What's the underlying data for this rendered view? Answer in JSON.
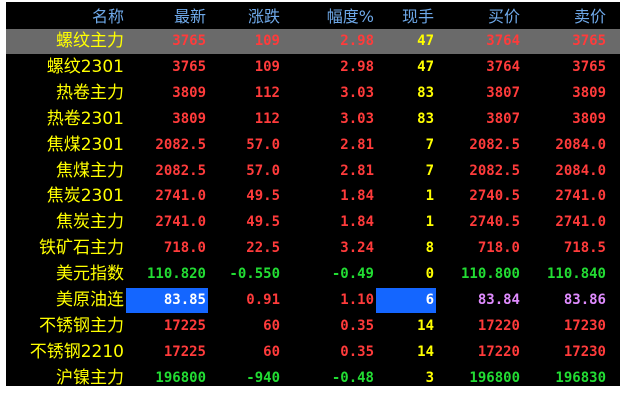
{
  "colors": {
    "up": "#ff3b3b",
    "down": "#22dd33",
    "flat": "#ffff00",
    "volume": "#ffff00",
    "highlight_bg": "#1466ff",
    "selected_bg": "#6a6a6a",
    "header": "#6ea8e8",
    "violet": "#e08cff",
    "white": "#ffffff"
  },
  "columns": {
    "name": "名称",
    "last": "最新",
    "change": "涨跌",
    "pct": "幅度%",
    "volume": "现手",
    "bid": "买价",
    "ask": "卖价"
  },
  "rows": [
    {
      "name": "螺纹主力",
      "last": "3765",
      "change": "109",
      "pct": "2.98",
      "volume": "47",
      "bid": "3764",
      "ask": "3765",
      "selected": true,
      "c_last": "up",
      "c_change": "up",
      "c_pct": "up",
      "c_bid": "up",
      "c_ask": "up"
    },
    {
      "name": "螺纹2301",
      "last": "3765",
      "change": "109",
      "pct": "2.98",
      "volume": "47",
      "bid": "3764",
      "ask": "3765",
      "c_last": "up",
      "c_change": "up",
      "c_pct": "up",
      "c_bid": "up",
      "c_ask": "up"
    },
    {
      "name": "热卷主力",
      "last": "3809",
      "change": "112",
      "pct": "3.03",
      "volume": "83",
      "bid": "3807",
      "ask": "3809",
      "c_last": "up",
      "c_change": "up",
      "c_pct": "up",
      "c_bid": "up",
      "c_ask": "up"
    },
    {
      "name": "热卷2301",
      "last": "3809",
      "change": "112",
      "pct": "3.03",
      "volume": "83",
      "bid": "3807",
      "ask": "3809",
      "c_last": "up",
      "c_change": "up",
      "c_pct": "up",
      "c_bid": "up",
      "c_ask": "up"
    },
    {
      "name": "焦煤2301",
      "last": "2082.5",
      "change": "57.0",
      "pct": "2.81",
      "volume": "7",
      "bid": "2082.5",
      "ask": "2084.0",
      "c_last": "up",
      "c_change": "up",
      "c_pct": "up",
      "c_bid": "up",
      "c_ask": "up"
    },
    {
      "name": "焦煤主力",
      "last": "2082.5",
      "change": "57.0",
      "pct": "2.81",
      "volume": "7",
      "bid": "2082.5",
      "ask": "2084.0",
      "c_last": "up",
      "c_change": "up",
      "c_pct": "up",
      "c_bid": "up",
      "c_ask": "up"
    },
    {
      "name": "焦炭2301",
      "last": "2741.0",
      "change": "49.5",
      "pct": "1.84",
      "volume": "1",
      "bid": "2740.5",
      "ask": "2741.0",
      "c_last": "up",
      "c_change": "up",
      "c_pct": "up",
      "c_bid": "up",
      "c_ask": "up"
    },
    {
      "name": "焦炭主力",
      "last": "2741.0",
      "change": "49.5",
      "pct": "1.84",
      "volume": "1",
      "bid": "2740.5",
      "ask": "2741.0",
      "c_last": "up",
      "c_change": "up",
      "c_pct": "up",
      "c_bid": "up",
      "c_ask": "up"
    },
    {
      "name": "铁矿石主力",
      "last": "718.0",
      "change": "22.5",
      "pct": "3.24",
      "volume": "8",
      "bid": "718.0",
      "ask": "718.5",
      "c_last": "up",
      "c_change": "up",
      "c_pct": "up",
      "c_bid": "up",
      "c_ask": "up"
    },
    {
      "name": "美元指数",
      "last": "110.820",
      "change": "-0.550",
      "pct": "-0.49",
      "volume": "0",
      "bid": "110.800",
      "ask": "110.840",
      "c_last": "down",
      "c_change": "down",
      "c_pct": "down",
      "c_bid": "down",
      "c_ask": "down"
    },
    {
      "name": "美原油连",
      "last": "83.85",
      "change": "0.91",
      "pct": "1.10",
      "volume": "6",
      "bid": "83.84",
      "ask": "83.86",
      "c_last": "white",
      "c_change": "up",
      "c_pct": "up",
      "c_bid": "violet",
      "c_ask": "violet",
      "hl_last": true,
      "hl_volume": true,
      "c_volume": "white"
    },
    {
      "name": "不锈钢主力",
      "last": "17225",
      "change": "60",
      "pct": "0.35",
      "volume": "14",
      "bid": "17220",
      "ask": "17230",
      "c_last": "up",
      "c_change": "up",
      "c_pct": "up",
      "c_bid": "up",
      "c_ask": "up"
    },
    {
      "name": "不锈钢2210",
      "last": "17225",
      "change": "60",
      "pct": "0.35",
      "volume": "14",
      "bid": "17220",
      "ask": "17230",
      "c_last": "up",
      "c_change": "up",
      "c_pct": "up",
      "c_bid": "up",
      "c_ask": "up"
    },
    {
      "name": "沪镍主力",
      "last": "196800",
      "change": "-940",
      "pct": "-0.48",
      "volume": "3",
      "bid": "196800",
      "ask": "196830",
      "c_last": "down",
      "c_change": "down",
      "c_pct": "down",
      "c_bid": "down",
      "c_ask": "down"
    }
  ]
}
